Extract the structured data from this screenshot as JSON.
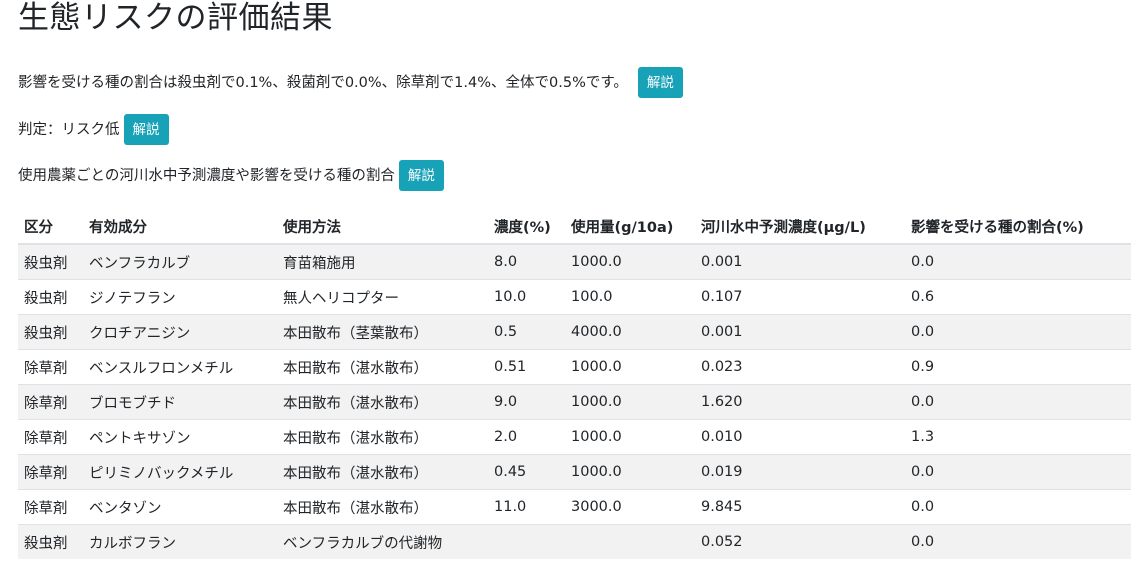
{
  "title": "生態リスクの評価結果",
  "summary_text": "影響を受ける種の割合は殺虫剤で0.1%、殺菌剤で0.0%、除草剤で1.4%、全体で0.5%です。",
  "judgement_text": "判定：リスク低",
  "usage_text": "使用農薬ごとの河川水中予測濃度や影響を受ける種の割合",
  "explain_label": "解説",
  "table": {
    "headers": [
      "区分",
      "有効成分",
      "使用方法",
      "濃度(%)",
      "使用量(g/10a)",
      "河川水中予測濃度(μg/L)",
      "影響を受ける種の割合(%)"
    ],
    "rows": [
      [
        "殺虫剤",
        "ベンフラカルブ",
        "育苗箱施用",
        "8.0",
        "1000.0",
        "0.001",
        "0.0"
      ],
      [
        "殺虫剤",
        "ジノテフラン",
        "無人ヘリコプター",
        "10.0",
        "100.0",
        "0.107",
        "0.6"
      ],
      [
        "殺虫剤",
        "クロチアニジン",
        "本田散布（茎葉散布）",
        "0.5",
        "4000.0",
        "0.001",
        "0.0"
      ],
      [
        "除草剤",
        "ベンスルフロンメチル",
        "本田散布（湛水散布）",
        "0.51",
        "1000.0",
        "0.023",
        "0.9"
      ],
      [
        "除草剤",
        "ブロモブチド",
        "本田散布（湛水散布）",
        "9.0",
        "1000.0",
        "1.620",
        "0.0"
      ],
      [
        "除草剤",
        "ペントキサゾン",
        "本田散布（湛水散布）",
        "2.0",
        "1000.0",
        "0.010",
        "1.3"
      ],
      [
        "除草剤",
        "ピリミノバックメチル",
        "本田散布（湛水散布）",
        "0.45",
        "1000.0",
        "0.019",
        "0.0"
      ],
      [
        "除草剤",
        "ベンタゾン",
        "本田散布（湛水散布）",
        "11.0",
        "3000.0",
        "9.845",
        "0.0"
      ],
      [
        "殺虫剤",
        "カルボフラン",
        "ベンフラカルブの代謝物",
        "",
        "",
        "0.052",
        "0.0"
      ]
    ]
  },
  "colors": {
    "button": "#17a2b8",
    "stripe": "#f2f2f2",
    "text": "#212529"
  }
}
